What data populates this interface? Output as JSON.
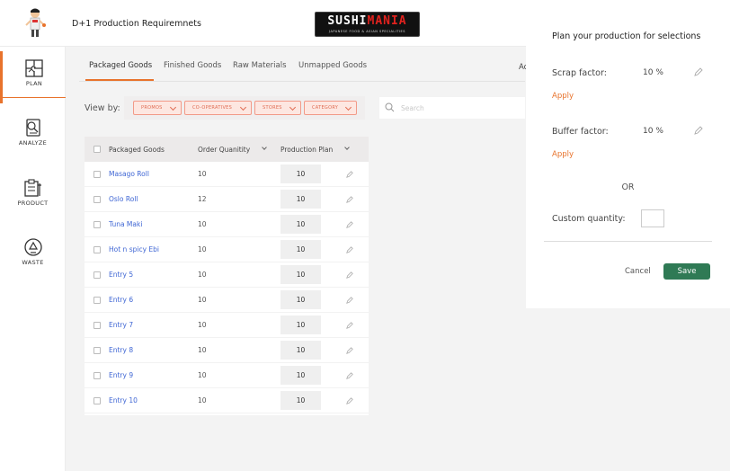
{
  "header": {
    "title": "D+1 Production Requiremnets",
    "brand_main_white": "SUSHI",
    "brand_main_red": "MANIA",
    "brand_sub": "JAPANESE FOOD & ASIAN SPECIALITIES",
    "colors": {
      "accent": "#e8732c",
      "brand_red": "#e0221e"
    }
  },
  "sidebar": {
    "items": [
      {
        "label": "PLAN",
        "icon": "plan-puzzle-icon",
        "active": true
      },
      {
        "label": "ANALYZE",
        "icon": "analyze-report-icon",
        "active": false
      },
      {
        "label": "PRODUCT",
        "icon": "product-cart-icon",
        "active": false
      },
      {
        "label": "WASTE",
        "icon": "waste-recycle-icon",
        "active": false
      }
    ]
  },
  "tabs": [
    {
      "label": "Packaged Goods",
      "active": true
    },
    {
      "label": "Finished Goods",
      "active": false
    },
    {
      "label": "Raw Materials",
      "active": false
    },
    {
      "label": "Unmapped Goods",
      "active": false
    }
  ],
  "partial_label": "Ac",
  "filters": {
    "view_by_label": "View by:",
    "chips": [
      "PROMOS",
      "CO-OPERATIVES",
      "STORES",
      "CATEGORY"
    ],
    "search_placeholder": "Search"
  },
  "table": {
    "headers": {
      "name": "Packaged Goods",
      "qty": "Order Quanitity",
      "plan": "Production Plan"
    },
    "rows": [
      {
        "name": "Masago Roll",
        "qty": "10",
        "plan": "10"
      },
      {
        "name": "Oslo Roll",
        "qty": "12",
        "plan": "10"
      },
      {
        "name": "Tuna Maki",
        "qty": "10",
        "plan": "10"
      },
      {
        "name": "Hot n spicy Ebi",
        "qty": "10",
        "plan": "10"
      },
      {
        "name": "Entry 5",
        "qty": "10",
        "plan": "10"
      },
      {
        "name": "Entry 6",
        "qty": "10",
        "plan": "10"
      },
      {
        "name": "Entry 7",
        "qty": "10",
        "plan": "10"
      },
      {
        "name": "Entry 8",
        "qty": "10",
        "plan": "10"
      },
      {
        "name": "Entry 9",
        "qty": "10",
        "plan": "10"
      },
      {
        "name": "Entry 10",
        "qty": "10",
        "plan": "10"
      }
    ]
  },
  "panel": {
    "title": "Plan your production for selections",
    "scrap_label": "Scrap factor:",
    "scrap_value": "10 %",
    "buffer_label": "Buffer factor:",
    "buffer_value": "10 %",
    "apply_label": "Apply",
    "or_label": "OR",
    "custom_label": "Custom quantity:",
    "custom_value": "",
    "cancel_label": "Cancel",
    "save_label": "Save",
    "save_color": "#2f7a55"
  }
}
